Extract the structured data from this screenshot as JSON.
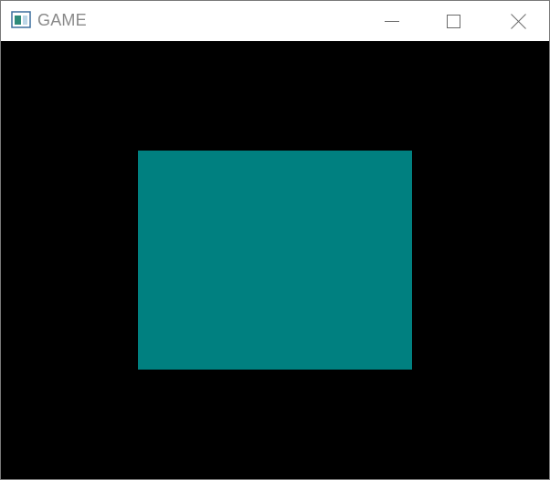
{
  "window": {
    "title": "GAME",
    "app_icon": "window-app-icon",
    "controls": {
      "minimize_icon": "minimize-icon",
      "maximize_icon": "maximize-icon",
      "close_icon": "close-icon"
    }
  },
  "game": {
    "background_color": "#000000",
    "rect_color": "#008080"
  },
  "colors": {
    "title_text": "#8a8a8a",
    "titlebar_bg": "#ffffff",
    "window_border": "#7a7a7a"
  }
}
